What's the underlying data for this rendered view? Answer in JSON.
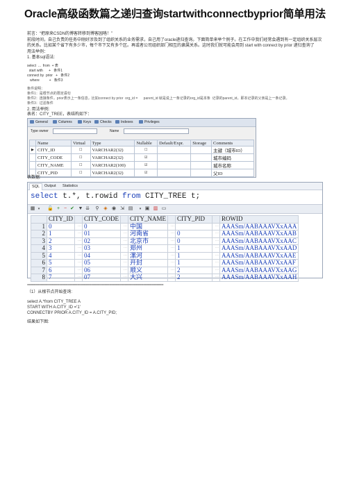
{
  "page_title": "Oracle高级函数篇之递归查询startwithconnectbyprior简单用法",
  "intro": {
    "line1": "前言：“把原来CSDN的博客转移到博客园咯！”",
    "line2": "前段时间，自己负责的任务中刚好涉及到了组织关系的业务需求，自己用了oracle递归查询。下面简单来举个例子。在工作中我们经常会遇到有一定组织关系层次",
    "line3": "的关系。比如某个省下有多少市，每个市下又有多个区。再或者公司组织部门相互的隶属关系。这时我们就可能会用到 start with connect by prior 递归查询了",
    "line4": "用法举例：",
    "section1": "1. 基本sql语法:"
  },
  "syntax": [
    "select  ...  from  + 表",
    "  start with      +   条件1",
    "connect by  prior   +   条件2",
    "   where          +   条件3"
  ],
  "conditions": {
    "heading": "条件说明：",
    "c1": "条件1：是根节点的限定语句",
    "c2": "条件2：连接条件，prior表示上一条信息，比如connect by prior  org_id =      parent_id 就是说上一条记录的org_id是本条  记录的parent_id，即本记录的父亲是上一条记录。",
    "c3": "条件3：过滤条件"
  },
  "example": {
    "section2": "2. 用法举例:",
    "table_desc": "表名：CITY_TREE，表结构如下：",
    "data_label": "表数据:"
  },
  "design_window": {
    "tabs": [
      "General",
      "Columns",
      "Keys",
      "Checks",
      "Indexes",
      "Privileges"
    ],
    "type_owner_label": "Type owner",
    "name_label": "Name",
    "headers": [
      "",
      "Name",
      "Virtual",
      "Type",
      "Nullable",
      "Default/Expr.",
      "Storage",
      "Comments"
    ],
    "rows": [
      {
        "marker": "▶",
        "name": "CITY_ID",
        "virtual": "☐",
        "type": "VARCHAR2(32)",
        "nullable": "☐",
        "comments": "主键（城市ID）"
      },
      {
        "marker": "",
        "name": "CITY_CODE",
        "virtual": "☐",
        "type": "VARCHAR2(32)",
        "nullable": "☑",
        "comments": "城市编码"
      },
      {
        "marker": "",
        "name": "CITY_NAME",
        "virtual": "☐",
        "type": "VARCHAR2(100)",
        "nullable": "☑",
        "comments": "城市名称"
      },
      {
        "marker": "",
        "name": "CITY_PID",
        "virtual": "☐",
        "type": "VARCHAR2(32)",
        "nullable": "☑",
        "comments": "父ID"
      }
    ]
  },
  "query_window": {
    "tabs": [
      "SQL",
      "Output",
      "Statistics"
    ],
    "sql": {
      "kw1": "select",
      "p1": " t.*, t.rowid ",
      "kw2": "from",
      "p2": " CITY_TREE t;"
    },
    "headers": [
      "",
      "CITY_ID",
      "",
      "CITY_CODE",
      "",
      "CITY_NAME",
      "",
      "CITY_PID",
      "",
      "ROWID"
    ],
    "rows": [
      {
        "n": "1",
        "id": "0",
        "code": "0",
        "name": "中国",
        "pid": "",
        "rowid": "AAASm/AABAAAVXxAAA"
      },
      {
        "n": "2",
        "id": "1",
        "code": "01",
        "name": "河南省",
        "pid": "0",
        "rowid": "AAASm/AABAAAVXxAAB"
      },
      {
        "n": "3",
        "id": "2",
        "code": "02",
        "name": "北京市",
        "pid": "0",
        "rowid": "AAASm/AABAAAVXxAAC"
      },
      {
        "n": "4",
        "id": "3",
        "code": "03",
        "name": "郑州",
        "pid": "1",
        "rowid": "AAASm/AABAAAVXxAAD"
      },
      {
        "n": "5",
        "id": "4",
        "code": "04",
        "name": "漯河",
        "pid": "1",
        "rowid": "AAASm/AABAAAVXxAAE"
      },
      {
        "n": "6",
        "id": "5",
        "code": "05",
        "name": "开封",
        "pid": "1",
        "rowid": "AAASm/AABAAAVXxAAF"
      },
      {
        "n": "7",
        "id": "6",
        "code": "06",
        "name": "顺义",
        "pid": "2",
        "rowid": "AAASm/AABAAAVXxAAG"
      },
      {
        "n": "8",
        "id": "7",
        "code": "07",
        "name": "大兴",
        "pid": "2",
        "rowid": "AAASm/AABAAAVXxAAH"
      }
    ]
  },
  "separator": "=================================================================================",
  "query1": {
    "heading": "（1）从根节点开始查询:",
    "lines": [
      "select A.*from CITY_TREE A",
      "START WITH A.CITY_ID ='1'",
      "CONNECTBY PRIOR A.CITY_ID = A.CITY_PID;"
    ],
    "result_label": "结果如下图:"
  }
}
